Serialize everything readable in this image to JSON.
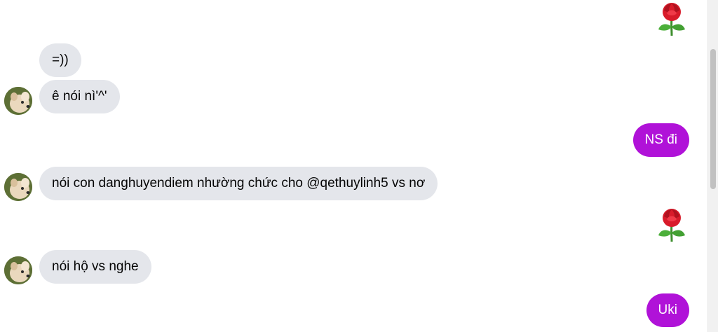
{
  "messages": [
    {
      "id": "m1",
      "direction": "out",
      "type": "emoji",
      "emoji": "rose"
    },
    {
      "id": "m2",
      "direction": "in",
      "text": "=))"
    },
    {
      "id": "m3",
      "direction": "in",
      "text": "ê nói nì'^'"
    },
    {
      "id": "m4",
      "direction": "out",
      "text": "NS đi"
    },
    {
      "id": "m5",
      "direction": "in",
      "text": "nói con danghuyendiem nhường chức cho @qethuylinh5 vs nơ"
    },
    {
      "id": "m6",
      "direction": "out",
      "type": "emoji",
      "emoji": "rose"
    },
    {
      "id": "m7",
      "direction": "in",
      "text": "nói hộ vs nghe"
    },
    {
      "id": "m8",
      "direction": "out",
      "text": "Uki"
    }
  ],
  "colors": {
    "incoming_bubble": "#e4e6eb",
    "outgoing_bubble": "#b012d8",
    "background": "#ffffff"
  },
  "icons": {
    "contact_avatar": "dog-avatar",
    "sticker": "rose-icon"
  }
}
